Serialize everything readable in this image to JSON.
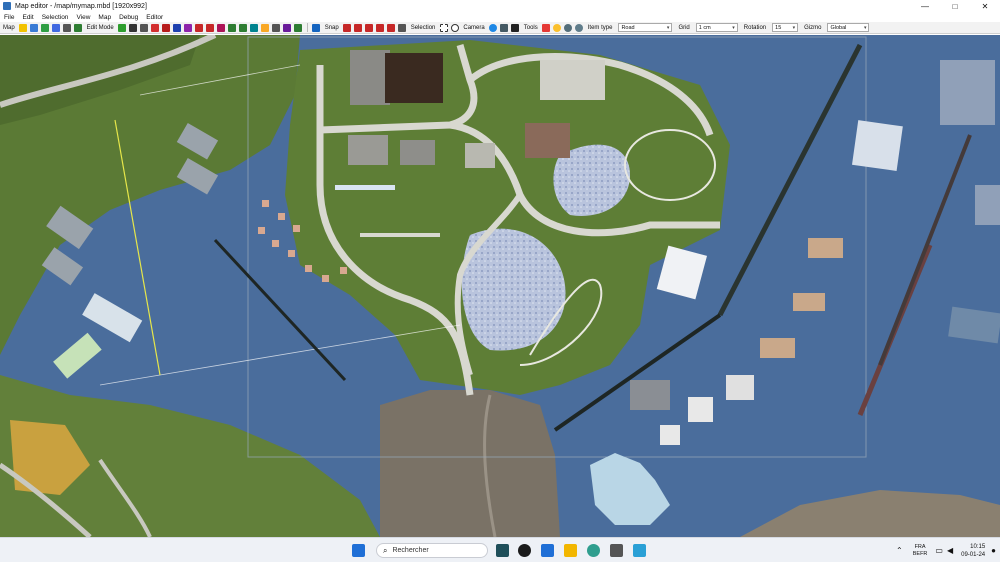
{
  "window": {
    "title": "Map editor - /map/mymap.mbd [1920x992]",
    "controls": [
      "—",
      "□",
      "✕"
    ]
  },
  "menu": [
    "File",
    "Edit",
    "Selection",
    "View",
    "Map",
    "Debug",
    "Editor"
  ],
  "toolbar": {
    "map_label": "Map",
    "edit_mode_label": "Edit Mode",
    "snap_label": "Snap",
    "selection_label": "Selection",
    "camera_label": "Camera",
    "tools_label": "Tools",
    "item_type_label": "Item type",
    "item_type_value": "Road",
    "grid_label": "Grid",
    "grid_value": "1 cm",
    "rotation_label": "Rotation",
    "rotation_value": "15",
    "gizmo_label": "Gizmo",
    "gizmo_value": "Global"
  },
  "taskbar": {
    "search_placeholder": "Rechercher",
    "lang_top": "FRA",
    "lang_bottom": "BEFR",
    "time": "10:15",
    "date": "09-01-24"
  },
  "colors": {
    "water": "#4a6d9c",
    "grass": "#5b7a35",
    "road": "#d8d8d0",
    "sand": "#7a7266"
  }
}
